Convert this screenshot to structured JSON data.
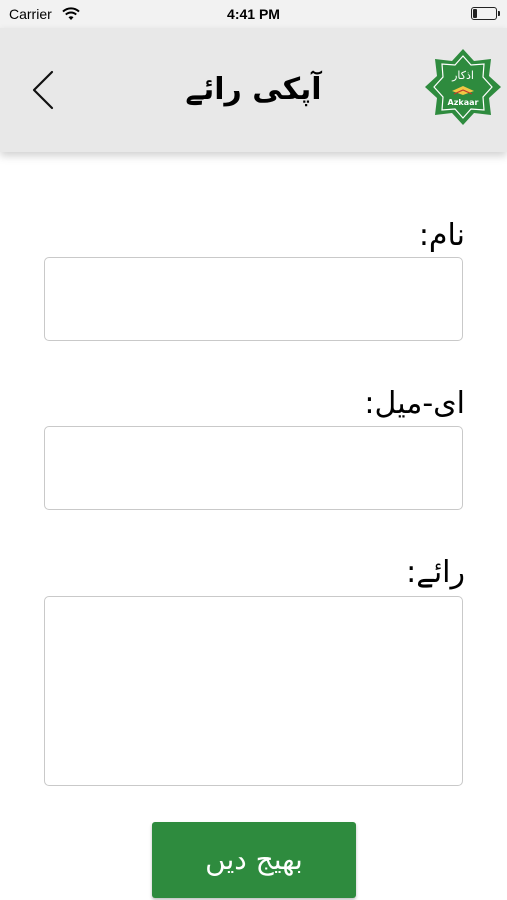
{
  "status_bar": {
    "carrier": "Carrier",
    "time": "4:41 PM"
  },
  "nav": {
    "title": "آپکی رائے",
    "logo_text_top": "اذکار",
    "logo_text_bottom": "Azkaar",
    "back_icon": "chevron-left-icon"
  },
  "form": {
    "name_label": "نام:",
    "email_label": "ای-میل:",
    "feedback_label": "رائے:",
    "name_value": "",
    "email_value": "",
    "feedback_value": ""
  },
  "submit_label": "بھیج دیں",
  "colors": {
    "accent_green": "#2e8b3e",
    "navbar_bg": "#e8e8e8"
  }
}
